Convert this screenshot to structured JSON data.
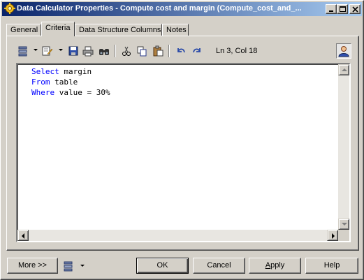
{
  "window": {
    "title": "Data Calculator Properties - Compute cost and margin (Compute_cost_and_..."
  },
  "tabs": [
    {
      "label": "General"
    },
    {
      "label": "Criteria"
    },
    {
      "label": "Data Structure Columns"
    },
    {
      "label": "Notes"
    }
  ],
  "active_tab": "Criteria",
  "toolbar": {
    "cursor_position": "Ln 3, Col 18",
    "icons": [
      "properties-icon",
      "edit-icon",
      "save-icon",
      "print-icon",
      "find-icon",
      "cut-icon",
      "copy-icon",
      "paste-icon",
      "undo-icon",
      "redo-icon",
      "user-icon"
    ]
  },
  "editor": {
    "lines": [
      {
        "keyword": "Select",
        "rest": " margin"
      },
      {
        "keyword": "From",
        "rest": " table"
      },
      {
        "keyword": "Where",
        "rest": " value = 30%"
      }
    ]
  },
  "footer": {
    "more_label": "More >>",
    "ok_label": "OK",
    "cancel_label": "Cancel",
    "apply_label": "Apply",
    "apply_prefix": "",
    "apply_underline": "A",
    "apply_suffix": "pply",
    "help_label": "Help"
  },
  "colors": {
    "title_start": "#0a246a",
    "title_end": "#a6caf0",
    "keyword": "#0000ff",
    "face": "#d4d0c8"
  }
}
